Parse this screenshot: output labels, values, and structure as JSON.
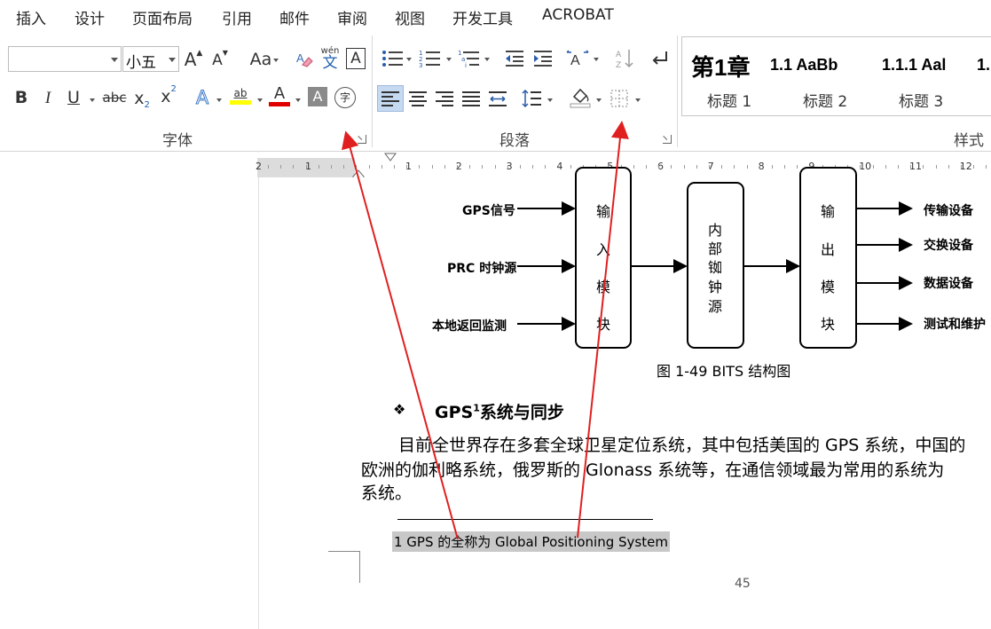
{
  "tabs": [
    "插入",
    "设计",
    "页面布局",
    "引用",
    "邮件",
    "审阅",
    "视图",
    "开发工具",
    "ACROBAT"
  ],
  "font": {
    "name_value": "",
    "size_value": "小五",
    "grow_label": "A",
    "shrink_label": "A",
    "case_label": "Aa",
    "phonetic_top": "wén",
    "phonetic_bottom": "文",
    "border_char_label": "A",
    "bold_label": "B",
    "italic_label": "I",
    "underline_label": "U",
    "strike_label": "abc",
    "subscript_label": "x",
    "subscript_mark": "2",
    "superscript_label": "x",
    "superscript_mark": "2",
    "effects_label": "A",
    "highlight_label": "ab",
    "font_color_label": "A",
    "shading_label": "A",
    "enclose_label": "字",
    "group_label": "字体"
  },
  "paragraph": {
    "group_label": "段落"
  },
  "styles": {
    "group_label": "样式",
    "items": [
      {
        "preview": "第1章",
        "label": "标题 1"
      },
      {
        "preview": "1.1  AaBb",
        "label": "标题 2"
      },
      {
        "preview": "1.1.1  Aal",
        "label": "标题 3"
      },
      {
        "preview": "1.",
        "label": ""
      }
    ]
  },
  "ruler": {
    "numbers": [
      "2",
      "1",
      "1",
      "2",
      "3",
      "4",
      "5",
      "6",
      "7",
      "8",
      "9",
      "10",
      "11",
      "12"
    ]
  },
  "diagram": {
    "inputs": [
      "GPS信号",
      "PRC 时钟源",
      "本地返回监测"
    ],
    "input_module": [
      "输",
      "入",
      "模",
      "块"
    ],
    "internal": [
      "内",
      "部",
      "铷",
      "钟",
      "源"
    ],
    "output_module": [
      "输",
      "出",
      "模",
      "块"
    ],
    "outputs": [
      "传输设备",
      "交换设备",
      "数据设备",
      "测试和维护"
    ],
    "caption": "图 1-49 BITS 结构图"
  },
  "section": {
    "bullet": "❖",
    "heading_main": "GPS",
    "heading_sup": "1",
    "heading_rest": "系统与同步"
  },
  "body": {
    "line1": "目前全世界存在多套全球卫星定位系统，其中包括美国的 GPS 系统，中国的",
    "line2": "欧洲的伽利略系统，俄罗斯的 Glonass 系统等，在通信领域最为常用的系统为",
    "line3": "系统。"
  },
  "footnote": {
    "text": "1  GPS 的全称为 Global Positioning System"
  },
  "page_number": "45",
  "colors": {
    "annotation": "#e02020",
    "highlight": "#ffff00",
    "font_red": "#e00000",
    "selection": "#c5d9f1"
  }
}
